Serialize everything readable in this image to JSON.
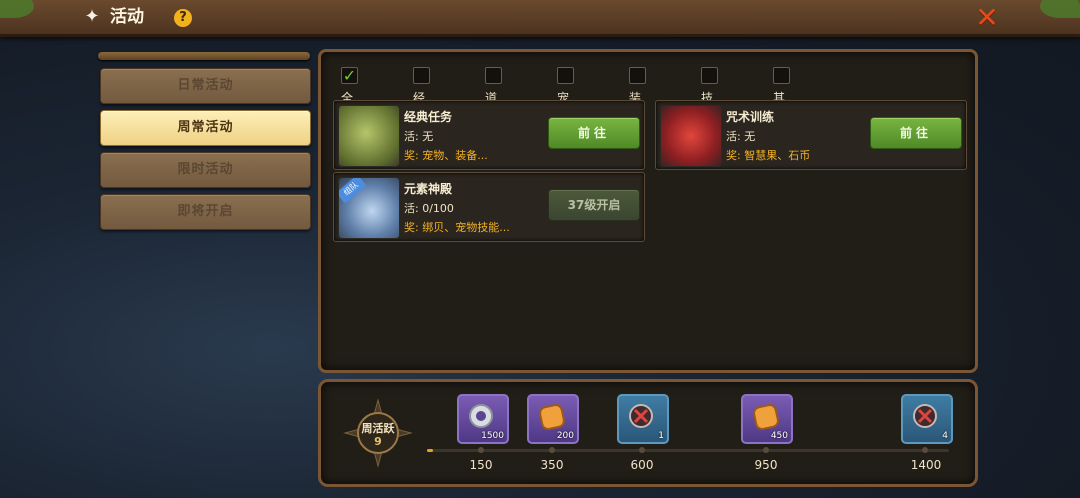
{
  "header": {
    "title": "活动",
    "help_icon": "?",
    "close_icon": "✕"
  },
  "sidebar": {
    "items": [
      {
        "label": "日常活动",
        "active": false
      },
      {
        "label": "周常活动",
        "active": true
      },
      {
        "label": "限时活动",
        "active": false
      },
      {
        "label": "即将开启",
        "active": false
      }
    ]
  },
  "filters": [
    {
      "label": "全部",
      "checked": true
    },
    {
      "label": "经验",
      "checked": false
    },
    {
      "label": "道具",
      "checked": false
    },
    {
      "label": "宠物",
      "checked": false
    },
    {
      "label": "装备",
      "checked": false
    },
    {
      "label": "技能",
      "checked": false
    },
    {
      "label": "其他",
      "checked": false
    }
  ],
  "activities": [
    {
      "name": "经典任务",
      "activity": "活: 无",
      "reward": "奖: 宠物、装备...",
      "button": "前往",
      "locked": false,
      "icon": "scroll-icon"
    },
    {
      "name": "咒术训练",
      "activity": "活: 无",
      "reward": "奖: 智慧果、石币",
      "button": "前往",
      "locked": false,
      "icon": "red-dragon-icon"
    },
    {
      "name": "元素神殿",
      "activity": "活: 0/100",
      "reward": "奖: 绑贝、宠物技能...",
      "button": "37级开启",
      "locked": true,
      "icon": "temple-icon",
      "tag": "组队"
    }
  ],
  "weekly": {
    "label": "周活跃",
    "value": "9",
    "progress_fraction": 0.0,
    "milestones": [
      {
        "value": "150",
        "qty": "1500",
        "type": "purple",
        "icon": "silver-ring-icon"
      },
      {
        "value": "350",
        "qty": "200",
        "type": "purple",
        "icon": "gold-coin-icon"
      },
      {
        "value": "600",
        "qty": "1",
        "type": "blue",
        "icon": "red-gem-icon"
      },
      {
        "value": "950",
        "qty": "450",
        "type": "purple",
        "icon": "gold-coin-icon"
      },
      {
        "value": "1400",
        "qty": "4",
        "type": "blue",
        "icon": "red-gem-icon"
      }
    ]
  },
  "colors": {
    "accent_gold": "#f4b227",
    "button_green": "#5f9a30",
    "frame_brown": "#7a5634"
  }
}
